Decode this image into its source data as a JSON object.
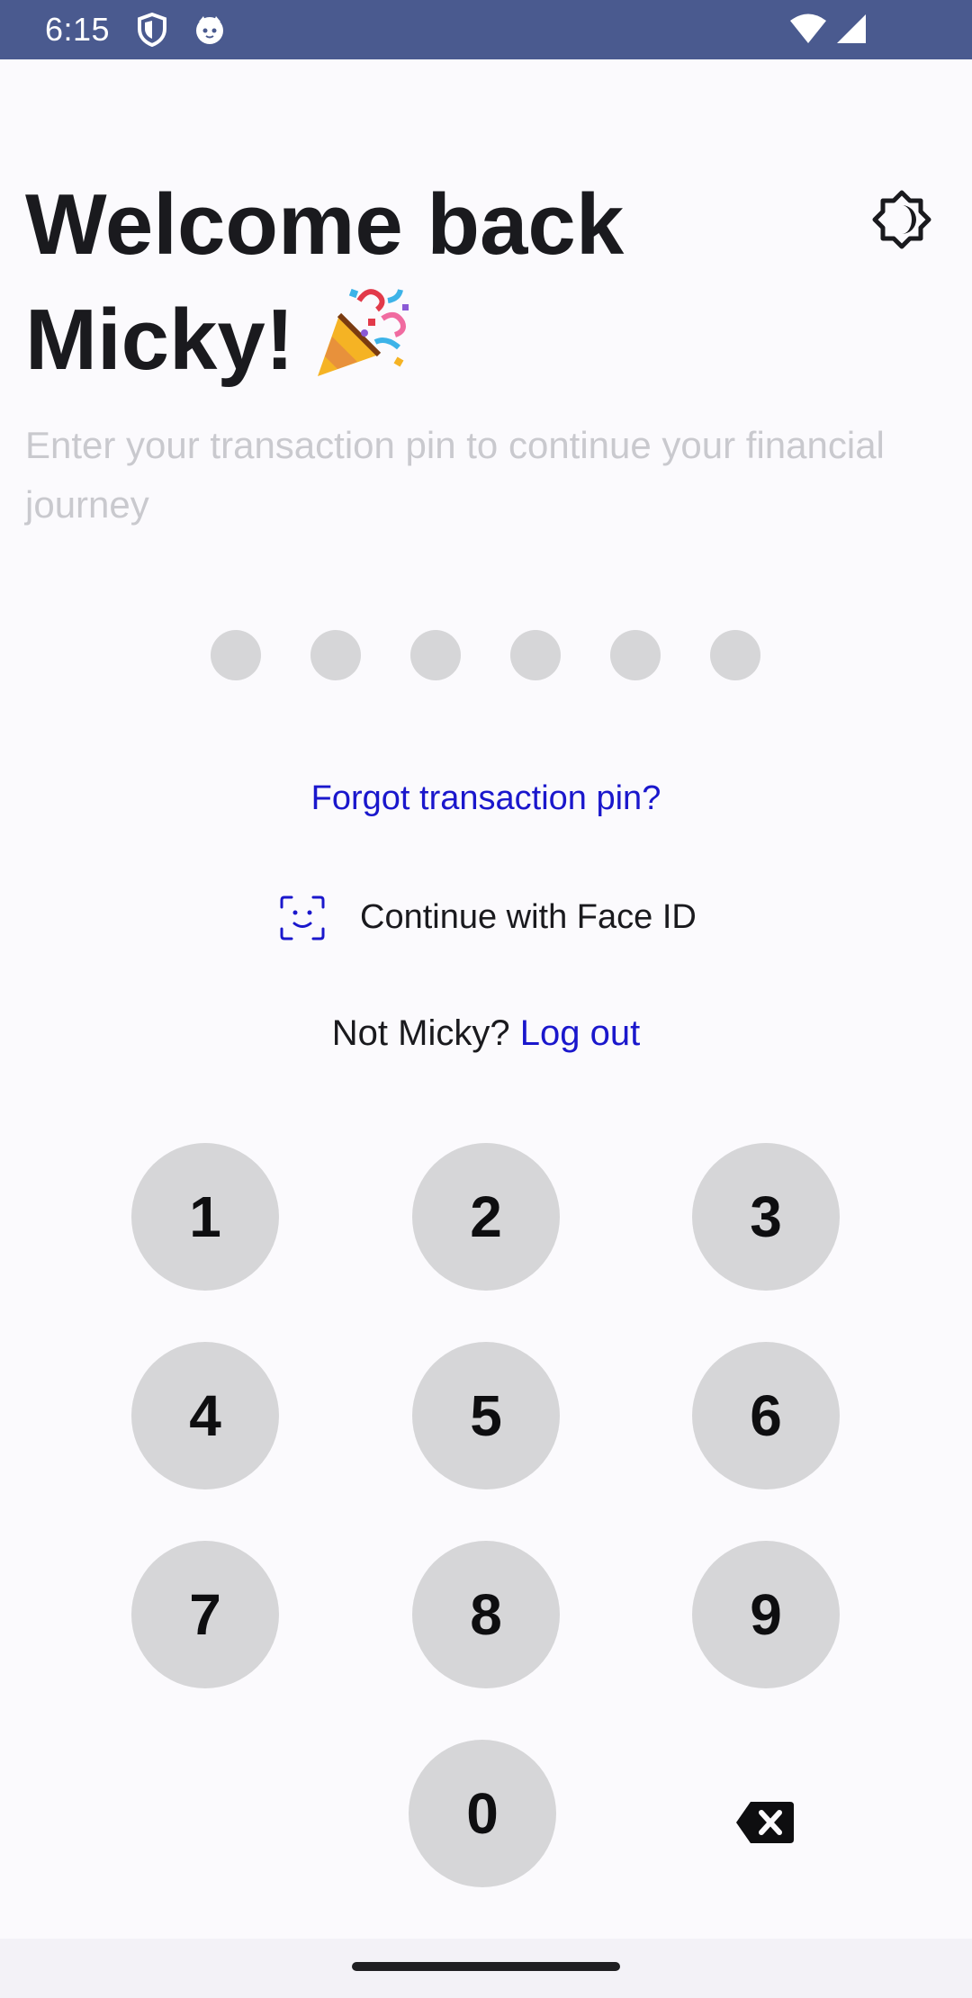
{
  "status_bar": {
    "time": "6:15",
    "left_icons": [
      "shield-icon",
      "cat-icon"
    ],
    "right_icons": [
      "wifi-icon",
      "cell-signal-icon"
    ],
    "background": "#4a5a8f"
  },
  "header": {
    "title_line1": "Welcome back",
    "title_line2": "Micky!",
    "title_emoji_icon": "party-popper-icon",
    "subtitle": "Enter your transaction pin to continue your financial journey",
    "theme_toggle_icon": "brightness-icon"
  },
  "pin": {
    "length": 6,
    "entered": 0
  },
  "links": {
    "forgot_pin": "Forgot transaction pin?",
    "face_id": "Continue with Face ID",
    "face_id_icon": "face-scan-icon",
    "not_user_prefix": "Not Micky?",
    "logout": "Log out"
  },
  "keypad": {
    "keys": [
      "1",
      "2",
      "3",
      "4",
      "5",
      "6",
      "7",
      "8",
      "9",
      "0"
    ],
    "backspace_icon": "backspace-icon"
  },
  "colors": {
    "accent": "#1a17cc",
    "key_background": "#d6d6d8",
    "title": "#1a1a1e",
    "subtitle": "#c9c9ce"
  }
}
